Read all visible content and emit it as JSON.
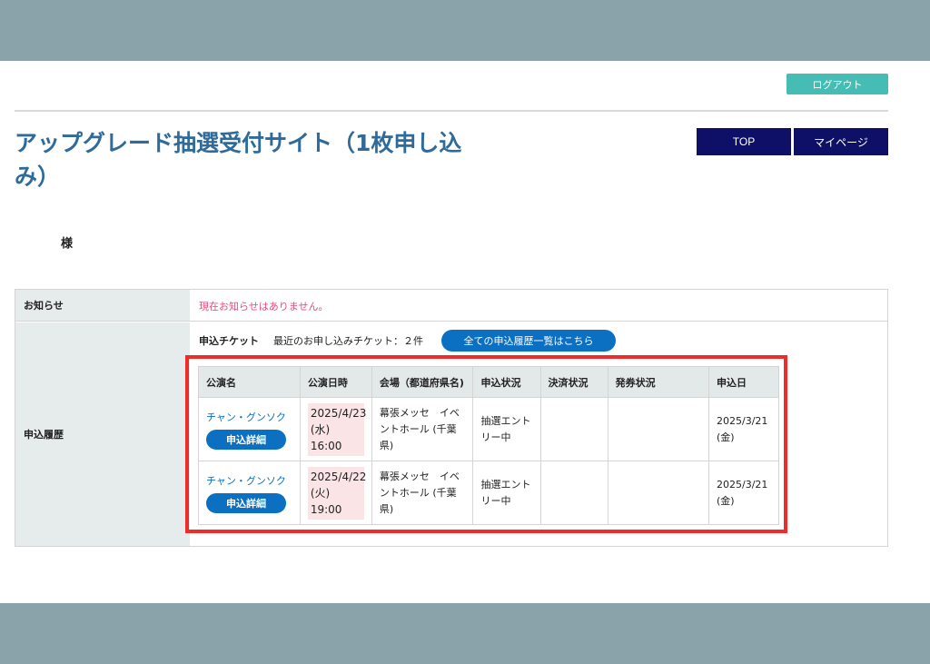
{
  "header": {
    "logout_label": "ログアウト",
    "site_title": "アップグレード抽選受付サイト（1枚申し込み）",
    "nav_top": "TOP",
    "nav_mypage": "マイページ"
  },
  "user": {
    "honorific": "様"
  },
  "notice": {
    "label": "お知らせ",
    "text": "現在お知らせはありません。"
  },
  "history": {
    "label": "申込履歴",
    "ticket_label": "申込チケット",
    "ticket_count": "最近のお申し込みチケット：２件",
    "all_history_button": "全ての申込履歴一覧はこちら",
    "columns": [
      "公演名",
      "公演日時",
      "会場（都道府県名)",
      "申込状況",
      "決済状況",
      "発券状況",
      "申込日"
    ],
    "rows": [
      {
        "performance": "チャン・グンソク",
        "detail_button": "申込詳細",
        "date_line1": "2025/4/23",
        "date_line2": "(水)",
        "date_line3": "16:00",
        "venue": "幕張メッセ　イベントホール (千葉県)",
        "status": "抽選エントリー中",
        "payment": "",
        "ticketing": "",
        "applied_line1": "2025/3/21",
        "applied_line2": "(金)"
      },
      {
        "performance": "チャン・グンソク",
        "detail_button": "申込詳細",
        "date_line1": "2025/4/22",
        "date_line2": "(火)",
        "date_line3": "19:00",
        "venue": "幕張メッセ　イベントホール (千葉県)",
        "status": "抽選エントリー中",
        "payment": "",
        "ticketing": "",
        "applied_line1": "2025/3/21",
        "applied_line2": "(金)"
      }
    ]
  },
  "colors": {
    "accent_teal": "#45bdb4",
    "nav_navy": "#0e0f66",
    "link_blue": "#0b70c2",
    "title_blue": "#2f6b9a",
    "notice_pink": "#e84a7b",
    "highlight_red": "#ee2c2c"
  }
}
